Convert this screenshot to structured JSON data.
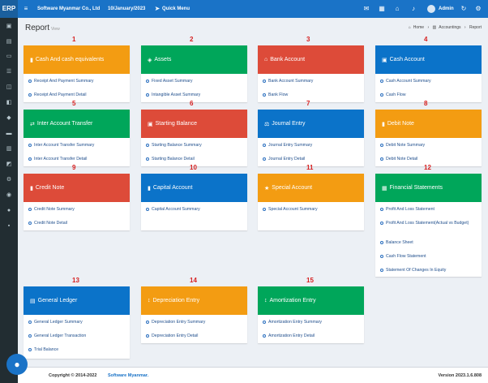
{
  "topbar": {
    "logo": "ERP",
    "company": "Software Myanmar Co., Ltd",
    "date": "10/January/2023",
    "quick_menu": "Quick Menu",
    "user": "Admin",
    "icons": [
      "chat-icon",
      "calculator-icon",
      "home-icon",
      "bell-icon",
      "user-icon",
      "refresh-icon",
      "settings-icon"
    ]
  },
  "header": {
    "title": "Report",
    "subtitle": "View",
    "breadcrumb": [
      "Home",
      "Accountings",
      "Report"
    ]
  },
  "cards": [
    {
      "number": "1",
      "title": "Cash And cash equivalents",
      "color": "#f39c12",
      "icon": "file-icon",
      "links": [
        "Receipt And Payment Summary",
        "Receipt And Payment Detail"
      ]
    },
    {
      "number": "2",
      "title": "Assets",
      "color": "#00a65a",
      "icon": "cube-icon",
      "links": [
        "Fixed Asset Summary",
        "Intangible Asset Summary"
      ]
    },
    {
      "number": "3",
      "title": "Bank Account",
      "color": "#dd4b39",
      "icon": "bank-icon",
      "links": [
        "Bank Account Summary",
        "Bank Flow"
      ]
    },
    {
      "number": "4",
      "title": "Cash Account",
      "color": "#0b73c9",
      "icon": "money-icon",
      "links": [
        "Cash Account Summary",
        "Cash Flow"
      ]
    },
    {
      "number": "5",
      "title": "Inter Account Transfer",
      "color": "#00a65a",
      "icon": "transfer-icon",
      "links": [
        "Inter Account Transfer Summary",
        "Inter Account Transfer Detail"
      ]
    },
    {
      "number": "6",
      "title": "Starting Balance",
      "color": "#dd4b39",
      "icon": "money-icon",
      "links": [
        "Starting Balance Summary",
        "Starting Balance Detail"
      ]
    },
    {
      "number": "7",
      "title": "Journal Entry",
      "color": "#0b73c9",
      "icon": "scale-icon",
      "links": [
        "Journal Entry Summary",
        "Journal Entry Detail"
      ]
    },
    {
      "number": "8",
      "title": "Debit Note",
      "color": "#f39c12",
      "icon": "file-icon",
      "links": [
        "Debit Note Summary",
        "Debit Note Detail"
      ]
    },
    {
      "number": "9",
      "title": "Credit Note",
      "color": "#dd4b39",
      "icon": "file-icon",
      "links": [
        "Credit Note Summary",
        "Credit Note Detail"
      ]
    },
    {
      "number": "10",
      "title": "Capital Account",
      "color": "#0b73c9",
      "icon": "file-icon",
      "links": [
        "Capital Account Summary"
      ]
    },
    {
      "number": "11",
      "title": "Special Account",
      "color": "#f39c12",
      "icon": "star-icon",
      "links": [
        "Special Account Summary"
      ]
    },
    {
      "number": "12",
      "title": "Financial Statements",
      "color": "#00a65a",
      "icon": "table-icon",
      "links": [
        "Profit And Loss Statement",
        "Profit And Loss Statement(Actual vs Budget)",
        "Balance Sheet",
        "Cash Flow Statement",
        "Statement Of Changes In Equity"
      ]
    },
    {
      "number": "13",
      "title": "General Ledger",
      "color": "#0b73c9",
      "icon": "book-icon",
      "links": [
        "General Ledger Summary",
        "General Ledger Transaction",
        "Trial Balance"
      ]
    },
    {
      "number": "14",
      "title": "Depreciation Entry",
      "color": "#f39c12",
      "icon": "sort-icon",
      "links": [
        "Depreciation Entry Summary",
        "Depreciation Entry Detail"
      ]
    },
    {
      "number": "15",
      "title": "Amortization Entry",
      "color": "#00a65a",
      "icon": "sort-icon",
      "links": [
        "Amortization Entry Summary",
        "Amortization Entry Detail"
      ]
    }
  ],
  "footer": {
    "copyright": "Copyright © 2014-2022",
    "brand": "Software Myanmar.",
    "version": "Version 2023.1.6.808"
  }
}
